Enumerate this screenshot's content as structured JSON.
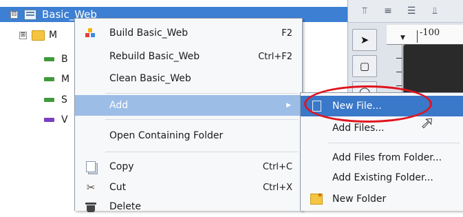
{
  "tree": {
    "root": {
      "label": "Basic_Web",
      "expander": "⊟"
    },
    "children": [
      {
        "label": "M",
        "icon": "folder-icon",
        "expander": "⊞"
      },
      {
        "label": "B",
        "icon": "file-icon",
        "color": "#3f9a3b"
      },
      {
        "label": "M",
        "icon": "file-icon",
        "color": "#3f9a3b"
      },
      {
        "label": "S",
        "icon": "file-icon",
        "color": "#3f9a3b"
      },
      {
        "label": "V",
        "icon": "file-icon",
        "color": "#7a3fbf"
      }
    ]
  },
  "right_panel": {
    "ruler_label": "-100"
  },
  "context_menu": {
    "items": [
      {
        "id": "build",
        "label": "Build Basic_Web",
        "shortcut": "F2"
      },
      {
        "id": "rebuild",
        "label": "Rebuild Basic_Web",
        "shortcut": "Ctrl+F2"
      },
      {
        "id": "clean",
        "label": "Clean Basic_Web",
        "shortcut": ""
      },
      {
        "id": "add",
        "label": "Add",
        "shortcut": "",
        "submenu_arrow": "▶"
      },
      {
        "id": "open_folder",
        "label": "Open Containing Folder",
        "shortcut": ""
      },
      {
        "id": "copy",
        "label": "Copy",
        "shortcut": "Ctrl+C"
      },
      {
        "id": "cut",
        "label": "Cut",
        "shortcut": "Ctrl+X"
      },
      {
        "id": "delete",
        "label": "Delete",
        "shortcut": ""
      }
    ]
  },
  "submenu": {
    "items": [
      {
        "id": "new_file",
        "label": "New File..."
      },
      {
        "id": "add_files",
        "label": "Add Files..."
      },
      {
        "id": "add_files_from_folder",
        "label": "Add Files from Folder..."
      },
      {
        "id": "add_existing_folder",
        "label": "Add Existing Folder..."
      },
      {
        "id": "new_folder",
        "label": "New Folder"
      }
    ]
  },
  "colors": {
    "selection": "#3a78c9",
    "highlight_ring": "#e0141e",
    "menu_background": "#f7f8fa"
  }
}
